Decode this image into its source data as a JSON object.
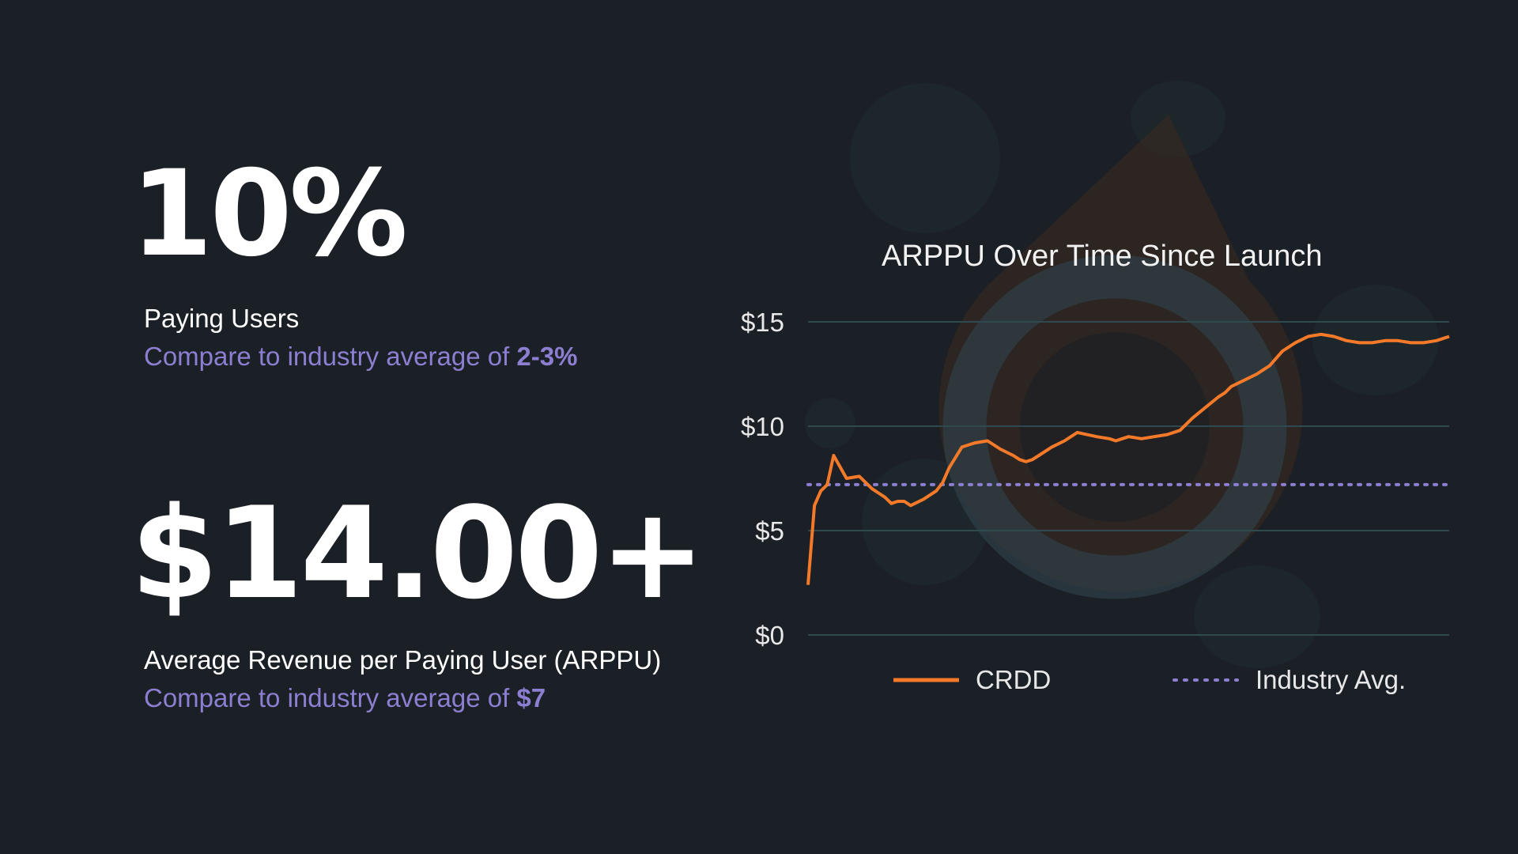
{
  "stats": [
    {
      "value": "10%",
      "label": "Paying Users",
      "compare_prefix": "Compare to industry average of ",
      "compare_value": "2-3%"
    },
    {
      "value": "$14.00+",
      "label": "Average Revenue per Paying User (ARPPU)",
      "compare_prefix": "Compare to industry average of ",
      "compare_value": "$7"
    }
  ],
  "colors": {
    "background": "#1b1f26",
    "accent_purple": "#8c7fd1",
    "series_orange": "#f47a2a",
    "industry_dotted": "#8c7fd1",
    "grid": "#2e4a4f"
  },
  "chart_data": {
    "type": "line",
    "title": "ARPPU Over Time Since Launch",
    "xlabel": "",
    "ylabel": "",
    "ylim": [
      0,
      15
    ],
    "yticks": [
      0,
      5,
      10,
      15
    ],
    "ytick_labels": [
      "$0",
      "$5",
      "$10",
      "$15"
    ],
    "grid": true,
    "legend_position": "bottom",
    "series": [
      {
        "name": "CRDD",
        "style": "solid",
        "x": [
          0,
          1,
          2,
          3,
          4,
          6,
          8,
          10,
          11,
          12,
          13,
          14,
          15,
          16,
          18,
          20,
          21,
          22,
          24,
          26,
          28,
          30,
          32,
          33,
          34,
          35,
          36,
          38,
          40,
          42,
          45,
          47,
          48,
          49,
          50,
          52,
          54,
          56,
          58,
          60,
          62,
          64,
          65,
          66,
          68,
          70,
          72,
          74,
          76,
          78,
          80,
          82,
          84,
          86,
          88,
          90,
          92,
          94,
          96,
          98,
          100
        ],
        "values": [
          2.4,
          6.2,
          6.9,
          7.2,
          8.6,
          7.5,
          7.6,
          7.0,
          6.8,
          6.6,
          6.3,
          6.4,
          6.4,
          6.2,
          6.5,
          6.9,
          7.3,
          8.0,
          9.0,
          9.2,
          9.3,
          8.9,
          8.6,
          8.4,
          8.3,
          8.4,
          8.6,
          9.0,
          9.3,
          9.7,
          9.5,
          9.4,
          9.3,
          9.4,
          9.5,
          9.4,
          9.5,
          9.6,
          9.8,
          10.4,
          10.9,
          11.4,
          11.6,
          11.9,
          12.2,
          12.5,
          12.9,
          13.6,
          14.0,
          14.3,
          14.4,
          14.3,
          14.1,
          14.0,
          14.0,
          14.1,
          14.1,
          14.0,
          14.0,
          14.1,
          14.3
        ]
      },
      {
        "name": "Industry Avg.",
        "style": "dotted",
        "constant": 7.2
      }
    ]
  }
}
